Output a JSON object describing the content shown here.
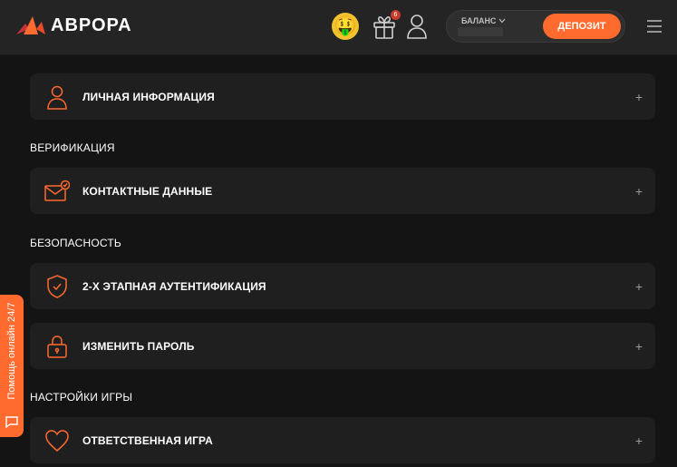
{
  "header": {
    "logo_text": "АВРОРА",
    "avatar_emoji": "🤑",
    "gift_badge": "6",
    "balance_label": "БАЛАНС",
    "deposit_label": "ДЕПОЗИТ",
    "icons": [
      "aurora-logo-icon",
      "gift-icon",
      "user-icon",
      "chevron-down-icon",
      "menu-icon"
    ]
  },
  "sections": {
    "personal": {
      "label": "ЛИЧНАЯ ИНФОРМАЦИЯ"
    },
    "verification_title": "ВЕРИФИКАЦИЯ",
    "contacts": {
      "label": "КОНТАКТНЫЕ ДАННЫЕ"
    },
    "security_title": "БЕЗОПАСНОСТЬ",
    "two_factor": {
      "label": "2-Х ЭТАПНАЯ АУТЕНТИФИКАЦИЯ"
    },
    "password": {
      "label": "ИЗМЕНИТЬ ПАРОЛЬ"
    },
    "game_settings_title": "НАСТРОЙКИ ИГРЫ",
    "responsible": {
      "label": "ОТВЕТСТВЕННАЯ ИГРА"
    },
    "expand_symbol": "+"
  },
  "help": {
    "label": "Помощь онлайн 24/7"
  },
  "colors": {
    "accent": "#ff6a2e",
    "background": "#141414",
    "card": "#1f1f1f",
    "header": "#242424"
  }
}
